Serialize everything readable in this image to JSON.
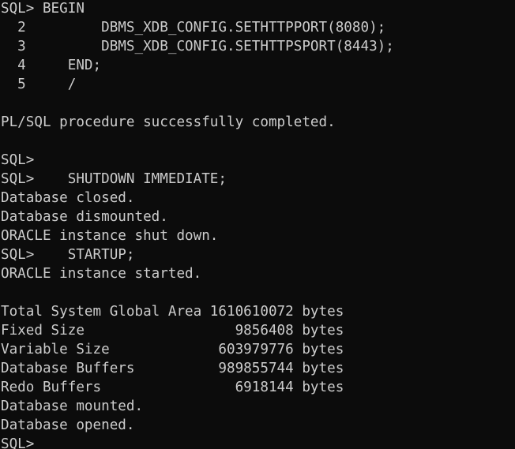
{
  "terminal": {
    "lines": [
      "SQL> BEGIN",
      "  2         DBMS_XDB_CONFIG.SETHTTPPORT(8080);",
      "  3         DBMS_XDB_CONFIG.SETHTTPSPORT(8443);",
      "  4     END;",
      "  5     /",
      "",
      "PL/SQL procedure successfully completed.",
      "",
      "SQL>",
      "SQL>    SHUTDOWN IMMEDIATE;",
      "Database closed.",
      "Database dismounted.",
      "ORACLE instance shut down.",
      "SQL>    STARTUP;",
      "ORACLE instance started.",
      "",
      "Total System Global Area 1610610072 bytes",
      "Fixed Size                  9856408 bytes",
      "Variable Size             603979776 bytes",
      "Database Buffers          989855744 bytes",
      "Redo Buffers                6918144 bytes",
      "Database mounted.",
      "Database opened.",
      "SQL>"
    ]
  }
}
